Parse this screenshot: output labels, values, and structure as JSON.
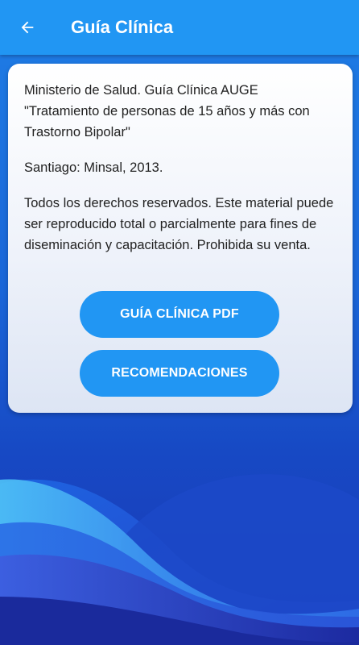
{
  "header": {
    "title": "Guía Clínica",
    "back_icon": "arrow-left-icon"
  },
  "card": {
    "paragraph_1": "Ministerio de Salud. Guía Clínica AUGE \"Tratamiento de personas de 15 años y más con Trastorno Bipolar\"",
    "paragraph_2": "Santiago: Minsal, 2013.",
    "paragraph_3": "Todos los derechos reservados. Este material puede ser reproducido total o parcialmente para fines de diseminación y capacitación. Prohibida su venta.",
    "pdf_button_label": "GUÍA CLÍNICA PDF",
    "recommendations_button_label": "RECOMENDACIONES"
  },
  "colors": {
    "appbar": "#2196f3",
    "button": "#2196f3",
    "background_dark": "#1a37b5"
  }
}
